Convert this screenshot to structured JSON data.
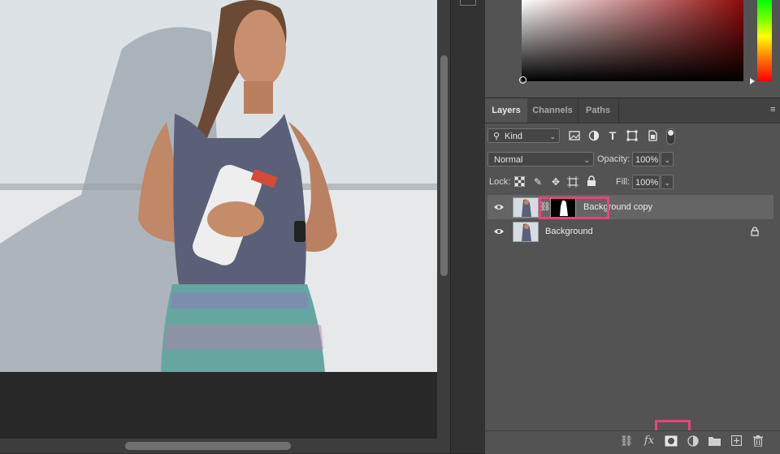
{
  "layers_panel": {
    "tabs": [
      {
        "label": "Layers"
      },
      {
        "label": "Channels"
      },
      {
        "label": "Paths"
      }
    ],
    "filter": {
      "label": "Kind"
    },
    "blend_mode": {
      "value": "Normal"
    },
    "opacity": {
      "label": "Opacity:",
      "value": "100%"
    },
    "lock": {
      "label": "Lock:"
    },
    "fill": {
      "label": "Fill:",
      "value": "100%"
    },
    "layers": [
      {
        "name": "Background copy",
        "has_mask": true,
        "visible": true,
        "selected": true
      },
      {
        "name": "Background",
        "locked": true,
        "visible": true,
        "selected": false
      }
    ]
  },
  "colors": {
    "highlight": "#e8447a",
    "panel_bg": "#535353",
    "selected_row": "#656565"
  }
}
